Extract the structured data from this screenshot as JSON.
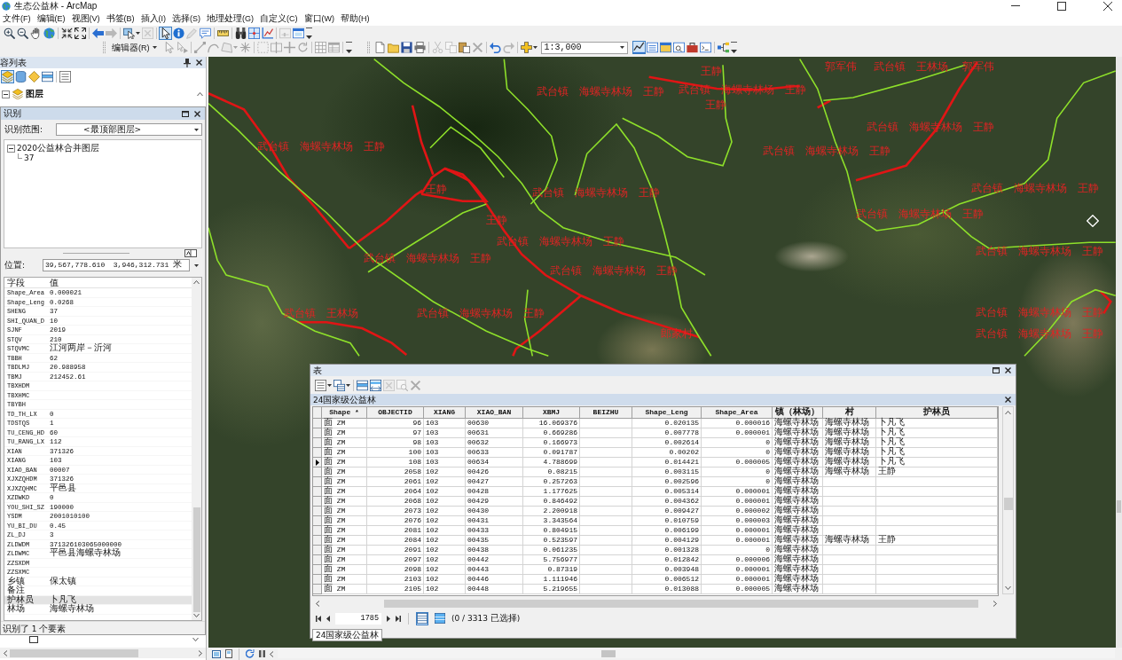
{
  "window": {
    "title": "生态公益林 - ArcMap"
  },
  "menu": [
    "文件(F)",
    "编辑(E)",
    "视图(V)",
    "书签(B)",
    "插入(I)",
    "选择(S)",
    "地理处理(G)",
    "自定义(C)",
    "窗口(W)",
    "帮助(H)"
  ],
  "tools_toolbar": [
    {
      "selected": false,
      "disabled": false
    },
    {
      "selected": false,
      "disabled": false
    },
    {
      "selected": false,
      "disabled": false
    },
    {
      "selected": false,
      "disabled": false
    },
    {
      "selected": false,
      "disabled": false
    },
    {
      "selected": false,
      "disabled": false
    },
    {
      "selected": false,
      "disabled": false
    },
    {
      "selected": false,
      "disabled": true
    },
    {
      "selected": false,
      "disabled": false
    },
    {
      "selected": false,
      "disabled": true
    },
    {
      "selected": true,
      "disabled": false
    },
    {
      "selected": false,
      "disabled": false
    },
    {
      "selected": false,
      "disabled": true
    },
    {
      "selected": false,
      "disabled": false
    },
    {
      "selected": false,
      "disabled": false
    },
    {
      "selected": false,
      "disabled": false
    },
    {
      "selected": false,
      "disabled": false
    },
    {
      "selected": false,
      "disabled": false
    },
    {
      "selected": false,
      "disabled": true
    },
    {
      "selected": false,
      "disabled": false
    },
    {
      "selected": false,
      "disabled": false
    }
  ],
  "editor_toolbar": {
    "label": "编辑器(R)",
    "buttons": [
      {
        "selected": false,
        "disabled": true
      },
      {
        "selected": false,
        "disabled": true
      },
      {
        "selected": false,
        "disabled": true
      },
      {
        "selected": false,
        "disabled": true
      },
      {
        "selected": false,
        "disabled": true
      },
      {
        "selected": false,
        "disabled": true
      },
      {
        "selected": false,
        "disabled": true
      },
      {
        "selected": false,
        "disabled": true
      },
      {
        "selected": false,
        "disabled": true
      },
      {
        "selected": false,
        "disabled": true
      },
      {
        "selected": false,
        "disabled": true
      },
      {
        "selected": false,
        "disabled": true
      },
      {
        "selected": false,
        "disabled": false
      }
    ]
  },
  "standard_toolbar": {
    "buttons": [
      {
        "selected": false,
        "disabled": false
      },
      {
        "selected": false,
        "disabled": false
      },
      {
        "selected": false,
        "disabled": false
      },
      {
        "selected": false,
        "disabled": false
      },
      {
        "selected": false,
        "disabled": true
      },
      {
        "selected": false,
        "disabled": true
      },
      {
        "selected": false,
        "disabled": false
      },
      {
        "selected": false,
        "disabled": true
      },
      {
        "selected": false,
        "disabled": false
      },
      {
        "selected": false,
        "disabled": true
      },
      {
        "selected": false,
        "disabled": false
      }
    ],
    "scale": "1:3,000",
    "window_buttons": [
      {
        "selected": true,
        "disabled": false
      },
      {
        "selected": false,
        "disabled": false
      },
      {
        "selected": false,
        "disabled": false
      },
      {
        "selected": false,
        "disabled": false
      },
      {
        "selected": false,
        "disabled": false
      },
      {
        "selected": false,
        "disabled": false
      },
      {
        "selected": false,
        "disabled": false
      },
      {
        "selected": false,
        "disabled": false
      }
    ]
  },
  "contents": {
    "title": "容列表",
    "toolbar": [
      {
        "selected": true
      },
      {
        "selected": false
      },
      {
        "selected": false
      },
      {
        "selected": false
      },
      {
        "selected": false
      }
    ],
    "root": {
      "label": "图层",
      "expanded": true
    }
  },
  "identify": {
    "title": "识别",
    "scope_label": "识别范围:",
    "scope_value": "<最顶部图层>",
    "tree": [
      {
        "label": "2020公益林合并图层",
        "expanded": true,
        "children": [
          {
            "label": "37"
          }
        ]
      }
    ],
    "location_label": "位置:",
    "location_value": "39,567,778.610  3,946,312.731 米",
    "columns": [
      "字段",
      "值"
    ],
    "fields": [
      {
        "field": "Shape_Area",
        "value": "0.000021",
        "selected": false
      },
      {
        "field": "Shape_Leng",
        "value": "0.0268",
        "selected": false
      },
      {
        "field": "SHENG",
        "value": "37",
        "selected": false
      },
      {
        "field": "SHI_QUAN_D",
        "value": "10",
        "selected": false
      },
      {
        "field": "SJNF",
        "value": "2019",
        "selected": false
      },
      {
        "field": "STQV",
        "value": "210",
        "selected": false
      },
      {
        "field": "STQVMC",
        "value": "江河两岸－沂河",
        "selected": false
      },
      {
        "field": "TBBH",
        "value": "62",
        "selected": false
      },
      {
        "field": "TBDLMJ",
        "value": "20.988958",
        "selected": false
      },
      {
        "field": "TBMJ",
        "value": "212452.61",
        "selected": false
      },
      {
        "field": "TBXHDM",
        "selected": false
      },
      {
        "field": "TBXHMC",
        "selected": false
      },
      {
        "field": "TBYBH",
        "selected": false
      },
      {
        "field": "TD_TH_LX",
        "value": "0",
        "selected": false
      },
      {
        "field": "TDSTQS",
        "value": "1",
        "selected": false
      },
      {
        "field": "TU_CENG_HD",
        "value": "60",
        "selected": false
      },
      {
        "field": "TU_RANG_LX",
        "value": "112",
        "selected": false
      },
      {
        "field": "XIAN",
        "value": "371326",
        "selected": false
      },
      {
        "field": "XIANG",
        "value": "103",
        "selected": false
      },
      {
        "field": "XIAO_BAN",
        "value": "00007",
        "selected": false
      },
      {
        "field": "XJXZQHDM",
        "value": "371326",
        "selected": false
      },
      {
        "field": "XJXZQHMC",
        "value": "平邑县",
        "selected": false
      },
      {
        "field": "XZDWKD",
        "value": "0",
        "selected": false
      },
      {
        "field": "YOU_SHI_SZ",
        "value": "190000",
        "selected": false
      },
      {
        "field": "YSDM",
        "value": "2001010100",
        "selected": false
      },
      {
        "field": "YU_BI_DU",
        "value": "0.45",
        "selected": false
      },
      {
        "field": "ZL_DJ",
        "value": "3",
        "selected": false
      },
      {
        "field": "ZLDWDM",
        "value": "371326103065000000",
        "selected": false
      },
      {
        "field": "ZLDWMC",
        "value": "平邑县海螺寺林场",
        "selected": false
      },
      {
        "field": "ZZSXDM",
        "selected": false
      },
      {
        "field": "ZZSXMC",
        "selected": false
      },
      {
        "field": "乡镇",
        "value": "保太镇",
        "selected": false
      },
      {
        "field": "备注",
        "selected": false
      },
      {
        "field": "护林员",
        "value": "卜凡飞",
        "selected": true
      },
      {
        "field": "林场",
        "value": "海螺寺林场",
        "selected": false
      }
    ],
    "status": "识别了 1 个要素"
  },
  "map": {
    "labels": [
      "王静",
      "郭军伟",
      "武台镇 王林场",
      "郭军伟",
      "武台镇 海螺寺林场 王静",
      "武台镇 海螺寺林场 王静",
      "王静",
      "武台镇 海螺寺林场 王静",
      "武台镇 海螺寺林场 王静",
      "武台镇 海螺寺林场 王静",
      "王静",
      "武台镇 海螺寺林场 王静",
      "武台镇 海螺寺林场 王静",
      "王静",
      "武台镇 海螺寺林场 王静",
      "武台镇 海螺寺林场 王静",
      "武台镇 海螺寺林场 王静",
      "武台镇 海螺寺林场 王静",
      "武台镇 海螺寺林场 王静",
      "武台镇 王林场",
      "武台镇 海螺寺林场 王静",
      "武台镇 海螺寺林场 王静",
      "郎家村",
      "武台镇 海螺寺林场 王静"
    ]
  },
  "table_window": {
    "title": "表",
    "toolbar": [
      {
        "selected": false,
        "disabled": false
      },
      {
        "selected": false,
        "disabled": false
      },
      {
        "selected": false,
        "disabled": false
      },
      {
        "selected": false,
        "disabled": false
      },
      {
        "selected": false,
        "disabled": true
      },
      {
        "selected": false,
        "disabled": true
      },
      {
        "selected": false,
        "disabled": true
      }
    ],
    "tab": "24国家级公益林",
    "columns": [
      "Shape *",
      "OBJECTID",
      "XIANG",
      "XIAO_BAN",
      "XBMJ",
      "BEIZHU",
      "Shape_Leng",
      "Shape_Area",
      "镇（林场）",
      "村",
      "护林员"
    ],
    "rows": [
      {
        "current": false,
        "shape": "面 ZM",
        "objectid": "96",
        "xiang": "103",
        "xiao_ban": "00630",
        "xbmj": "16.069376",
        "shape_leng": "0.020135",
        "shape_area": "0.000016",
        "town": "海螺寺林场",
        "village": "海螺寺林场",
        "ranger": "卜凡飞"
      },
      {
        "current": false,
        "shape": "面 ZM",
        "objectid": "97",
        "xiang": "103",
        "xiao_ban": "00631",
        "xbmj": "0.669286",
        "shape_leng": "0.007778",
        "shape_area": "0.000001",
        "town": "海螺寺林场",
        "village": "海螺寺林场",
        "ranger": "卜凡飞"
      },
      {
        "current": false,
        "shape": "面 ZM",
        "objectid": "98",
        "xiang": "103",
        "xiao_ban": "00632",
        "xbmj": "0.166973",
        "shape_leng": "0.002614",
        "shape_area": "0",
        "town": "海螺寺林场",
        "village": "海螺寺林场",
        "ranger": "卜凡飞"
      },
      {
        "current": false,
        "shape": "面 ZM",
        "objectid": "100",
        "xiang": "103",
        "xiao_ban": "00633",
        "xbmj": "0.091787",
        "shape_leng": "0.00202",
        "shape_area": "0",
        "town": "海螺寺林场",
        "village": "海螺寺林场",
        "ranger": "卜凡飞"
      },
      {
        "current": true,
        "shape": "面 ZM",
        "objectid": "108",
        "xiang": "103",
        "xiao_ban": "00634",
        "xbmj": "4.788699",
        "shape_leng": "0.014421",
        "shape_area": "0.000005",
        "town": "海螺寺林场",
        "village": "海螺寺林场",
        "ranger": "卜凡飞"
      },
      {
        "current": false,
        "shape": "面 ZM",
        "objectid": "2058",
        "xiang": "102",
        "xiao_ban": "00426",
        "xbmj": "0.08215",
        "shape_leng": "0.003115",
        "shape_area": "0",
        "town": "海螺寺林场",
        "village": "海螺寺林场",
        "ranger": "王静"
      },
      {
        "current": false,
        "shape": "面 ZM",
        "objectid": "2061",
        "xiang": "102",
        "xiao_ban": "00427",
        "xbmj": "0.257263",
        "shape_leng": "0.002596",
        "shape_area": "0",
        "town": "海螺寺林场"
      },
      {
        "current": false,
        "shape": "面 ZM",
        "objectid": "2064",
        "xiang": "102",
        "xiao_ban": "00428",
        "xbmj": "1.177625",
        "shape_leng": "0.005314",
        "shape_area": "0.000001",
        "town": "海螺寺林场"
      },
      {
        "current": false,
        "shape": "面 ZM",
        "objectid": "2068",
        "xiang": "102",
        "xiao_ban": "00429",
        "xbmj": "0.846492",
        "shape_leng": "0.004362",
        "shape_area": "0.000001",
        "town": "海螺寺林场"
      },
      {
        "current": false,
        "shape": "面 ZM",
        "objectid": "2073",
        "xiang": "102",
        "xiao_ban": "00430",
        "xbmj": "2.200918",
        "shape_leng": "0.009427",
        "shape_area": "0.000002",
        "town": "海螺寺林场"
      },
      {
        "current": false,
        "shape": "面 ZM",
        "objectid": "2076",
        "xiang": "102",
        "xiao_ban": "00431",
        "xbmj": "3.343564",
        "shape_leng": "0.010759",
        "shape_area": "0.000003",
        "town": "海螺寺林场"
      },
      {
        "current": false,
        "shape": "面 ZM",
        "objectid": "2081",
        "xiang": "102",
        "xiao_ban": "00433",
        "xbmj": "0.804915",
        "shape_leng": "0.006199",
        "shape_area": "0.000001",
        "town": "海螺寺林场"
      },
      {
        "current": false,
        "shape": "面 ZM",
        "objectid": "2084",
        "xiang": "102",
        "xiao_ban": "00435",
        "xbmj": "0.523597",
        "shape_leng": "0.004129",
        "shape_area": "0.000001",
        "town": "海螺寺林场",
        "village": "海螺寺林场",
        "ranger": "王静"
      },
      {
        "current": false,
        "shape": "面 ZM",
        "objectid": "2091",
        "xiang": "102",
        "xiao_ban": "00438",
        "xbmj": "0.061235",
        "shape_leng": "0.001328",
        "shape_area": "0",
        "town": "海螺寺林场"
      },
      {
        "current": false,
        "shape": "面 ZM",
        "objectid": "2097",
        "xiang": "102",
        "xiao_ban": "00442",
        "xbmj": "5.756977",
        "shape_leng": "0.012842",
        "shape_area": "0.000006",
        "town": "海螺寺林场"
      },
      {
        "current": false,
        "shape": "面 ZM",
        "objectid": "2098",
        "xiang": "102",
        "xiao_ban": "00443",
        "xbmj": "0.87319",
        "shape_leng": "0.003948",
        "shape_area": "0.000001",
        "town": "海螺寺林场"
      },
      {
        "current": false,
        "shape": "面 ZM",
        "objectid": "2103",
        "xiang": "102",
        "xiao_ban": "00446",
        "xbmj": "1.111946",
        "shape_leng": "0.006512",
        "shape_area": "0.000001",
        "town": "海螺寺林场"
      },
      {
        "current": false,
        "shape": "面 ZM",
        "objectid": "2105",
        "xiang": "102",
        "xiao_ban": "00448",
        "xbmj": "5.219655",
        "shape_leng": "0.013088",
        "shape_area": "0.000005",
        "town": "海螺寺林场"
      }
    ],
    "record": "1785",
    "view_buttons": [
      {
        "selected": true
      },
      {
        "selected": false
      }
    ],
    "selection_status": "(0 / 3313 已选择)",
    "bottom_tab": "24国家级公益林"
  }
}
